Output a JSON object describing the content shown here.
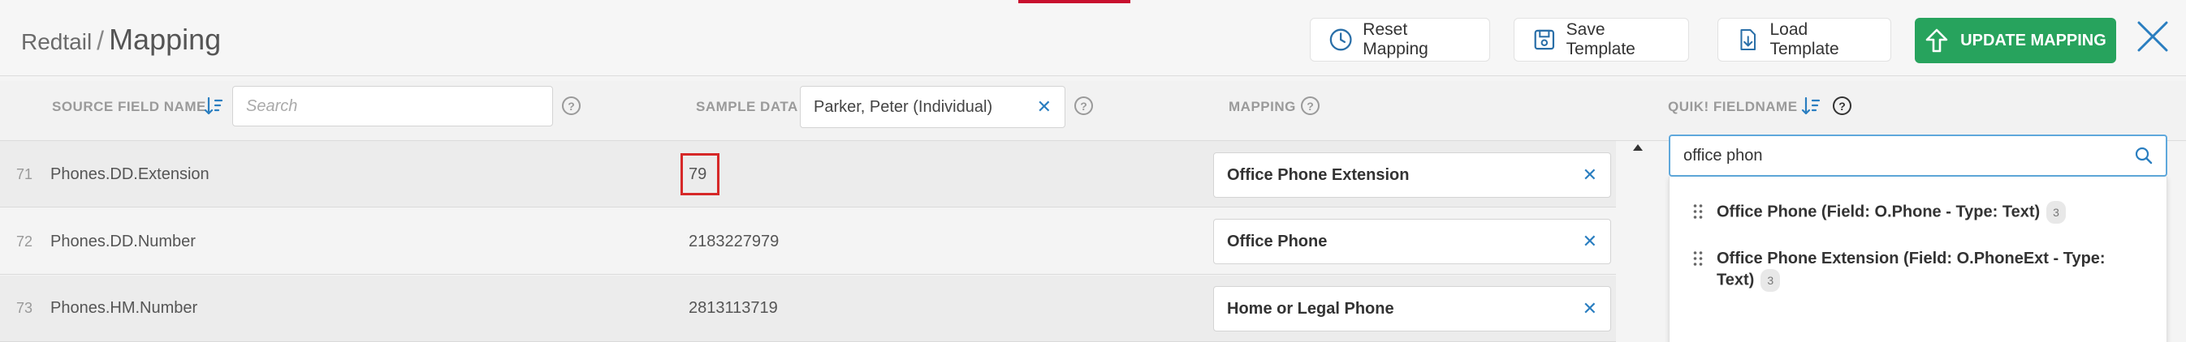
{
  "header": {
    "breadcrumb_root": "Redtail",
    "breadcrumb_sep": "/",
    "page_title": "Mapping",
    "buttons": {
      "reset": "Reset Mapping",
      "save": "Save Template",
      "load": "Load Template",
      "update": "UPDATE MAPPING"
    },
    "icons": {
      "reset": "clock-icon",
      "save": "floppy-disk-icon",
      "load": "file-download-icon",
      "update": "arrow-up-icon",
      "close": "close-icon"
    },
    "accent_color": "#c8102e",
    "update_color": "#27a35d"
  },
  "columns": {
    "source_field_name": "SOURCE FIELD NAME",
    "source_search_placeholder": "Search",
    "sample_data": "SAMPLE DATA",
    "sample_selected": "Parker, Peter (Individual)",
    "mapping": "MAPPING",
    "quik_fieldname": "QUIK! FIELDNAME",
    "help_glyph": "?"
  },
  "rows": [
    {
      "num": "71",
      "source": "Phones.DD.Extension",
      "sample": "79",
      "mapping": "Office Phone Extension",
      "highlighted": true
    },
    {
      "num": "72",
      "source": "Phones.DD.Number",
      "sample": "2183227979",
      "mapping": "Office Phone",
      "highlighted": false
    },
    {
      "num": "73",
      "source": "Phones.HM.Number",
      "sample": "2813113719",
      "mapping": "Home or Legal Phone",
      "highlighted": false
    }
  ],
  "quik": {
    "search_value": "office phon",
    "options": [
      {
        "label": "Office Phone (Field: O.Phone - Type: Text)",
        "count": "3"
      },
      {
        "label_line1": "Office Phone Extension (Field: O.PhoneExt - Type:",
        "label_line2": "Text)",
        "count": "3"
      }
    ]
  },
  "clear_glyph": "✕"
}
